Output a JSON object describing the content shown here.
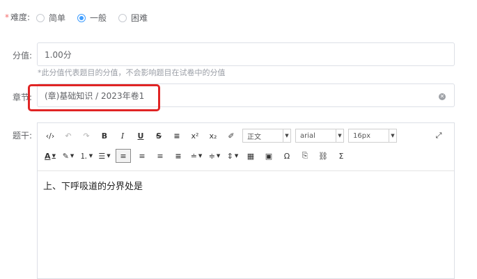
{
  "difficulty": {
    "required_mark": "*",
    "label": "难度:",
    "options": [
      {
        "label": "简单",
        "checked": false
      },
      {
        "label": "一般",
        "checked": true
      },
      {
        "label": "困难",
        "checked": false
      }
    ]
  },
  "score": {
    "label": "分值:",
    "value": "1.00分",
    "hint": "*此分值代表题目的分值，不会影响题目在试卷中的分值"
  },
  "chapter": {
    "label": "章节:",
    "value": "(章)基础知识 / 2023年卷1",
    "clear_icon": "close-circle-icon"
  },
  "stem": {
    "label": "题干:",
    "toolbar": {
      "row1": {
        "source": "‹/›",
        "undo": "↶",
        "redo": "↷",
        "bold": "B",
        "italic": "I",
        "underline": "U",
        "strikethrough": "S",
        "blockquote": "≡",
        "superscript": "x²",
        "subscript": "x₂",
        "eraser": "✐",
        "paragraph_select": "正文",
        "font_select": "arial",
        "size_select": "16px",
        "fullscreen": "⤢"
      },
      "row2": {
        "font_color": "A",
        "highlight": "✎",
        "ordered_list": "⒈",
        "unordered_list": "☰",
        "align_left": "≡",
        "align_center": "≡",
        "align_right": "≡",
        "justify": "≡",
        "row_spacing_top": "≐",
        "row_spacing_bottom": "≑",
        "line_height": "⇕",
        "table": "▦",
        "image": "▣",
        "special_char": "Ω",
        "template": "⎘",
        "link": "⛓",
        "formula": "Σ"
      }
    },
    "content": "上、下呼吸道的分界处是"
  }
}
